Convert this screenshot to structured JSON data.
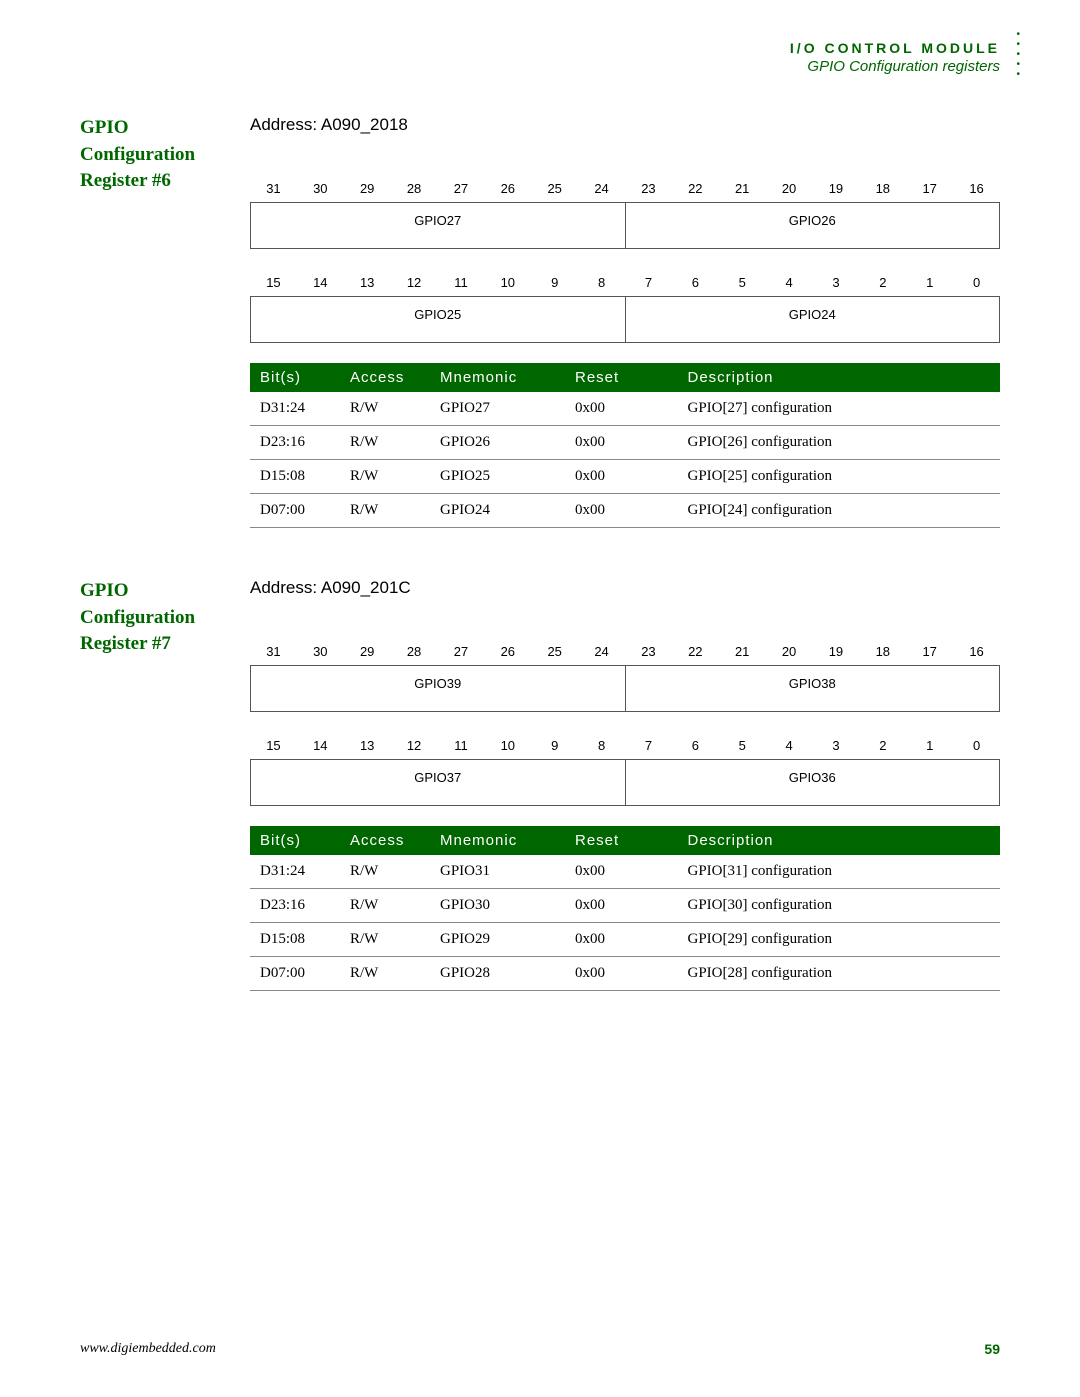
{
  "header": {
    "title": "I/O CONTROL MODULE",
    "subtitle": "GPIO Configuration registers"
  },
  "registers": [
    {
      "title": "GPIO Configuration Register #6",
      "address": "Address: A090_2018",
      "bit_rows": [
        {
          "numbers": [
            "31",
            "30",
            "29",
            "28",
            "27",
            "26",
            "25",
            "24",
            "23",
            "22",
            "21",
            "20",
            "19",
            "18",
            "17",
            "16"
          ],
          "fields": [
            {
              "label": "GPIO27",
              "span": 8
            },
            {
              "label": "GPIO26",
              "span": 8
            }
          ]
        },
        {
          "numbers": [
            "15",
            "14",
            "13",
            "12",
            "11",
            "10",
            "9",
            "8",
            "7",
            "6",
            "5",
            "4",
            "3",
            "2",
            "1",
            "0"
          ],
          "fields": [
            {
              "label": "GPIO25",
              "span": 8
            },
            {
              "label": "GPIO24",
              "span": 8
            }
          ]
        }
      ],
      "table": {
        "headers": [
          "Bit(s)",
          "Access",
          "Mnemonic",
          "Reset",
          "Description"
        ],
        "rows": [
          [
            "D31:24",
            "R/W",
            "GPIO27",
            "0x00",
            "GPIO[27] configuration"
          ],
          [
            "D23:16",
            "R/W",
            "GPIO26",
            "0x00",
            "GPIO[26] configuration"
          ],
          [
            "D15:08",
            "R/W",
            "GPIO25",
            "0x00",
            "GPIO[25] configuration"
          ],
          [
            "D07:00",
            "R/W",
            "GPIO24",
            "0x00",
            "GPIO[24] configuration"
          ]
        ]
      }
    },
    {
      "title": "GPIO Configuration Register #7",
      "address": "Address: A090_201C",
      "bit_rows": [
        {
          "numbers": [
            "31",
            "30",
            "29",
            "28",
            "27",
            "26",
            "25",
            "24",
            "23",
            "22",
            "21",
            "20",
            "19",
            "18",
            "17",
            "16"
          ],
          "fields": [
            {
              "label": "GPIO39",
              "span": 8
            },
            {
              "label": "GPIO38",
              "span": 8
            }
          ]
        },
        {
          "numbers": [
            "15",
            "14",
            "13",
            "12",
            "11",
            "10",
            "9",
            "8",
            "7",
            "6",
            "5",
            "4",
            "3",
            "2",
            "1",
            "0"
          ],
          "fields": [
            {
              "label": "GPIO37",
              "span": 8
            },
            {
              "label": "GPIO36",
              "span": 8
            }
          ]
        }
      ],
      "table": {
        "headers": [
          "Bit(s)",
          "Access",
          "Mnemonic",
          "Reset",
          "Description"
        ],
        "rows": [
          [
            "D31:24",
            "R/W",
            "GPIO31",
            "0x00",
            "GPIO[31] configuration"
          ],
          [
            "D23:16",
            "R/W",
            "GPIO30",
            "0x00",
            "GPIO[30] configuration"
          ],
          [
            "D15:08",
            "R/W",
            "GPIO29",
            "0x00",
            "GPIO[29] configuration"
          ],
          [
            "D07:00",
            "R/W",
            "GPIO28",
            "0x00",
            "GPIO[28] configuration"
          ]
        ]
      }
    }
  ],
  "footer": {
    "url": "www.digiembedded.com",
    "page": "59"
  }
}
